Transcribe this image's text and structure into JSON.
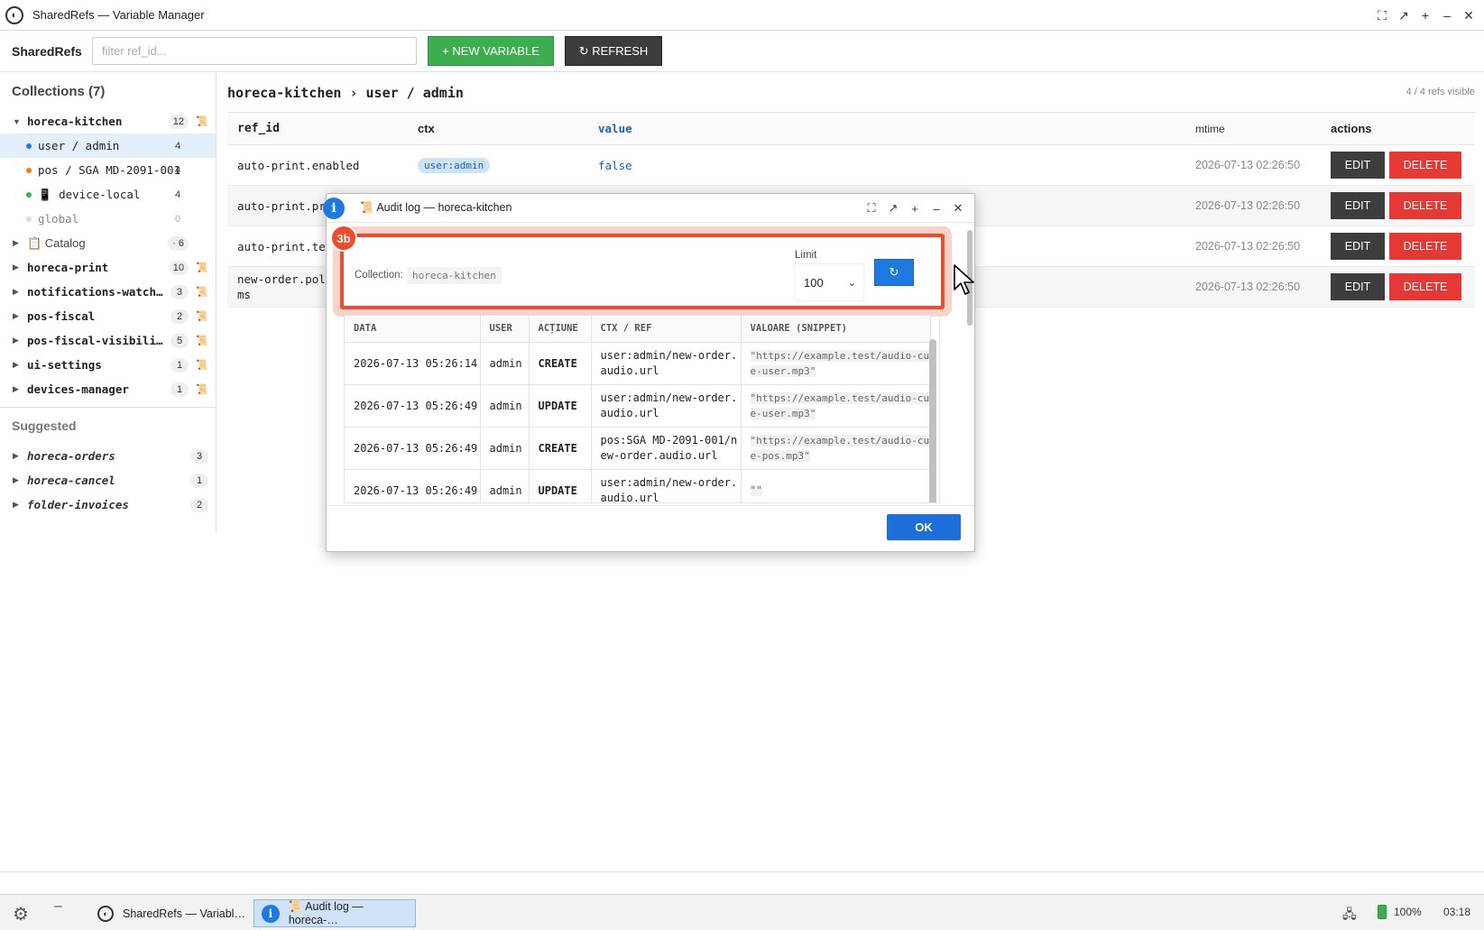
{
  "window": {
    "title": "SharedRefs — Variable Manager",
    "controls": [
      "⛶",
      "↗",
      "+",
      "–",
      "✕"
    ]
  },
  "toolbar": {
    "brand": "SharedRefs",
    "search_placeholder": "filter ref_id...",
    "new_variable_label": "+ NEW VARIABLE",
    "refresh_label": "↻ REFRESH"
  },
  "sidebar": {
    "collections_header": "Collections (7)",
    "active_collection": {
      "name": "horeca-kitchen",
      "count": "12"
    },
    "contexts": [
      {
        "label": "user / admin",
        "count": "4",
        "dot_color": "#1e7ae0"
      },
      {
        "label": "pos / SGA MD-2091-001",
        "count": "4",
        "dot_color": "#ee7d1f"
      },
      {
        "label": "📱 device-local",
        "count": "4",
        "dot_color": "#3cae4f"
      },
      {
        "label": "global",
        "count": "0",
        "dot_color": "#bbbbbb"
      }
    ],
    "catalog": {
      "label": "📋 Catalog",
      "count": "· 6"
    },
    "collections": [
      {
        "name": "horeca-print",
        "count": "10"
      },
      {
        "name": "notifications-watch…",
        "count": "3"
      },
      {
        "name": "pos-fiscal",
        "count": "2"
      },
      {
        "name": "pos-fiscal-visibili…",
        "count": "5"
      },
      {
        "name": "ui-settings",
        "count": "1"
      },
      {
        "name": "devices-manager",
        "count": "1"
      }
    ],
    "suggested_header": "Suggested",
    "suggested": [
      {
        "name": "horeca-orders",
        "count": "3"
      },
      {
        "name": "horeca-cancel",
        "count": "1"
      },
      {
        "name": "folder-invoices",
        "count": "2"
      }
    ]
  },
  "main": {
    "breadcrumb": "horeca-kitchen › user / admin",
    "visible_count": "4 / 4 refs visible",
    "columns": {
      "ref_id": "ref_id",
      "ctx": "ctx",
      "value": "value",
      "mtime": "mtime",
      "actions": "actions"
    },
    "rows": [
      {
        "ref_id": "auto-print.enabled",
        "ctx": "user:admin",
        "value": "false",
        "mtime": "2026-07-13 02:26:50"
      },
      {
        "ref_id": "auto-print.pri",
        "ctx": "",
        "value": "",
        "mtime": "2026-07-13 02:26:50"
      },
      {
        "ref_id": "auto-print.ten",
        "ctx": "",
        "value": "",
        "mtime": "2026-07-13 02:26:50"
      },
      {
        "ref_id": "new-order.poll\nms",
        "ctx": "",
        "value": "",
        "mtime": "2026-07-13 02:26:50"
      }
    ],
    "edit_label": "EDIT",
    "delete_label": "DELETE"
  },
  "dialog": {
    "title": "📜 Audit log — horeca-kitchen",
    "step_badge": "3b",
    "collection_label": "Collection:",
    "collection_value": "horeca-kitchen",
    "limit_label": "Limit",
    "limit_value": "100",
    "refresh_icon": "↻",
    "columns": {
      "date": "DATA",
      "user": "USER",
      "action": "ACȚIUNE",
      "ctx_ref": "CTX / REF",
      "value": "VALOARE (SNIPPET)"
    },
    "entries": [
      {
        "date": "2026-07-13 05:26:14",
        "user": "admin",
        "action": "CREATE",
        "ctx_ref": "user:admin/new-order.audio.url",
        "snippet": "\"https://example.test/audio-cue-user.mp3\""
      },
      {
        "date": "2026-07-13 05:26:49",
        "user": "admin",
        "action": "UPDATE",
        "ctx_ref": "user:admin/new-order.audio.url",
        "snippet": "\"https://example.test/audio-cue-user.mp3\""
      },
      {
        "date": "2026-07-13 05:26:49",
        "user": "admin",
        "action": "CREATE",
        "ctx_ref": "pos:SGA MD-2091-001/new-order.audio.url",
        "snippet": "\"https://example.test/audio-cue-pos.mp3\""
      },
      {
        "date": "2026-07-13 05:26:49",
        "user": "admin",
        "action": "UPDATE",
        "ctx_ref": "user:admin/new-order.audio.url",
        "snippet": "\"\""
      }
    ],
    "ok_label": "OK"
  },
  "taskbar": {
    "tasks": [
      {
        "label": "SharedRefs — Variabl…"
      },
      {
        "label": "📜 Audit log — horeca-…"
      }
    ],
    "battery": "100%",
    "time": "03:18"
  }
}
